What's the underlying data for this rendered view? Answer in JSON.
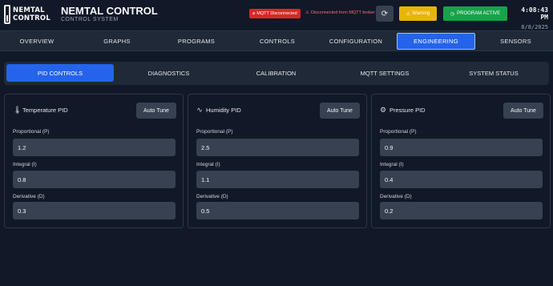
{
  "header": {
    "logo_line1": "NEMTAL",
    "logo_line2": "CONTROL",
    "title": "NEMTAL CONTROL",
    "subtitle": "CONTROL SYSTEM",
    "mqtt_status": "MQTT Disconnected",
    "mqtt_message": "Disconnected from MQTT broker",
    "refresh_icon": "refresh-icon",
    "warning_label": "Warning",
    "program_status": "PROGRAM ACTIVE",
    "time": "4:08:43 PM",
    "date": "8/8/2025"
  },
  "nav": {
    "items": [
      {
        "label": "OVERVIEW",
        "active": false
      },
      {
        "label": "GRAPHS",
        "active": false
      },
      {
        "label": "PROGRAMS",
        "active": false
      },
      {
        "label": "CONTROLS",
        "active": false
      },
      {
        "label": "CONFIGURATION",
        "active": false
      },
      {
        "label": "ENGINEERING",
        "active": true
      },
      {
        "label": "SENSORS",
        "active": false
      }
    ]
  },
  "subtabs": {
    "items": [
      {
        "label": "PID CONTROLS",
        "active": true
      },
      {
        "label": "DIAGNOSTICS",
        "active": false
      },
      {
        "label": "CALIBRATION",
        "active": false
      },
      {
        "label": "MQTT SETTINGS",
        "active": false
      },
      {
        "label": "SYSTEM STATUS",
        "active": false
      }
    ]
  },
  "panels": [
    {
      "title": "Temperature PID",
      "icon": "thermometer-icon",
      "auto_tune": "Auto Tune",
      "fields": [
        {
          "label": "Proportional (P)",
          "value": "1.2"
        },
        {
          "label": "Integral (I)",
          "value": "0.8"
        },
        {
          "label": "Derivative (D)",
          "value": "0.3"
        }
      ]
    },
    {
      "title": "Humidity PID",
      "icon": "activity-icon",
      "auto_tune": "Auto Tune",
      "fields": [
        {
          "label": "Proportional (P)",
          "value": "2.5"
        },
        {
          "label": "Integral (I)",
          "value": "1.1"
        },
        {
          "label": "Derivative (D)",
          "value": "0.5"
        }
      ]
    },
    {
      "title": "Pressure PID",
      "icon": "gear-icon",
      "auto_tune": "Auto Tune",
      "fields": [
        {
          "label": "Proportional (P)",
          "value": "0.9"
        },
        {
          "label": "Integral (I)",
          "value": "0.4"
        },
        {
          "label": "Derivative (D)",
          "value": "0.2"
        }
      ]
    }
  ],
  "colors": {
    "background": "#111827",
    "surface": "#1f2937",
    "input": "#374151",
    "accent": "#2563eb",
    "danger": "#dc2626",
    "warning": "#eab308",
    "success": "#16a34a"
  }
}
